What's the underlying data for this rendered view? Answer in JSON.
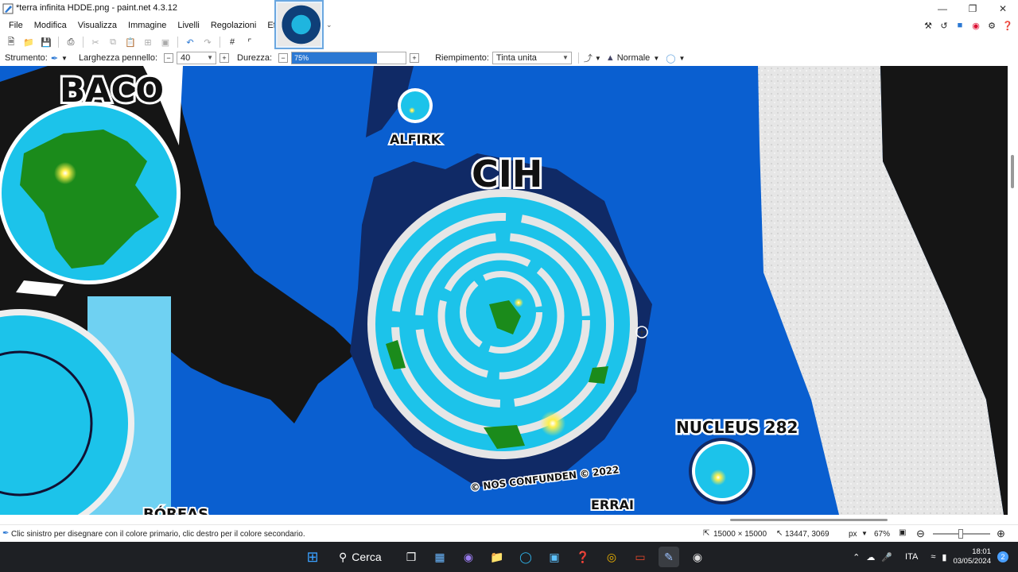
{
  "window": {
    "title": "*terra infinita HDDE.png - paint.net 4.3.12",
    "controls": [
      "minimize",
      "restore",
      "close"
    ]
  },
  "menu": {
    "items": [
      "File",
      "Modifica",
      "Visualizza",
      "Immagine",
      "Livelli",
      "Regolazioni",
      "Effetti"
    ]
  },
  "toolbar": {
    "icons": [
      "new-file-icon",
      "open-folder-icon",
      "save-icon",
      "print-icon",
      "cut-icon",
      "copy-icon",
      "paste-icon",
      "crop-icon",
      "deselect-icon",
      "undo-icon",
      "redo-icon",
      "grid-icon",
      "ruler-icon"
    ]
  },
  "tool_options": {
    "tool_label": "Strumento:",
    "brush_width_label": "Larghezza pennello:",
    "brush_width_value": "40",
    "hardness_label": "Durezza:",
    "hardness_value": "75%",
    "hardness_fraction": 0.75,
    "fill_label": "Riempimento:",
    "fill_value": "Tinta unita",
    "blend_label": "Normale"
  },
  "map_labels": {
    "baco": "BACO",
    "alfirk": "ALFIRK",
    "cih": "CIH",
    "nucleus": "NUCLEUS 282",
    "errai": "ERRAI",
    "copyright": "© NOS CONFUNDEN © 2022",
    "boreas": "BÓREAS"
  },
  "status": {
    "hint": "Clic sinistro per disegnare con il colore primario, clic destro per il colore secondario.",
    "image_size": "15000 × 15000",
    "cursor_pos": "13447, 3069",
    "unit": "px",
    "zoom": "67%"
  },
  "taskbar": {
    "search_label": "Cerca",
    "language": "ITA",
    "time": "18:01",
    "date": "03/05/2024",
    "notifications": "2"
  },
  "colors": {
    "accent": "#2b78d3",
    "ocean": "#0a5fd0",
    "land": "#1b8b1b",
    "dark_land": "#151515",
    "ice": "#e8e8e8",
    "shallow": "#1cc3ea"
  }
}
